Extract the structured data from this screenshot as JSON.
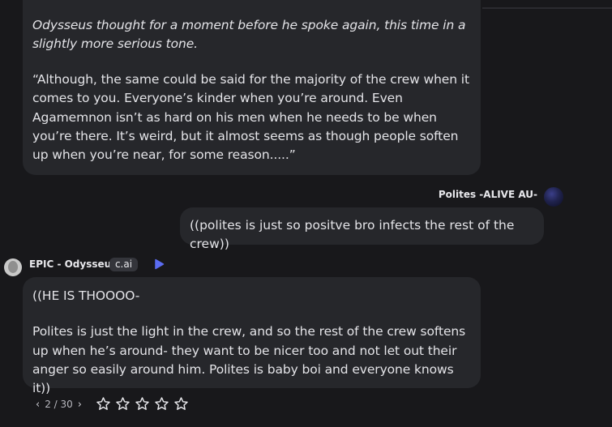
{
  "messages": [
    {
      "italic_text": "Odysseus thought for a moment before he spoke again, this time in a slightly more serious tone.",
      "body_text": "“Although, the same could be said for the majority of the crew when it comes to you. Everyone’s kinder when you’re around. Even Agamemnon isn’t as hard on his men when he needs to be when you’re there. It’s weird, but it almost seems as though people soften up when you’re near, for some reason.....”"
    }
  ],
  "user": {
    "name": "Polites -ALIVE AU-",
    "message": "((polites is just so positve bro infects the rest of the crew))"
  },
  "bot": {
    "name": "EPIC - Odysseus",
    "tag": "c.ai",
    "line1": "((HE IS THOOOO-",
    "line2": "Polites is just the light in the crew, and so the rest of the crew softens up when he’s around- they want to be nicer too and not let out their anger so easily around him. Polites is baby boi and everyone knows it))"
  },
  "pagination": {
    "prev": "‹",
    "current": "2 / 30",
    "next": "›"
  },
  "rating": {
    "stars": 5,
    "filled": 0
  },
  "colors": {
    "background": "#18181b",
    "bubble": "#26272b",
    "accent_play": "#5b6cf2"
  }
}
